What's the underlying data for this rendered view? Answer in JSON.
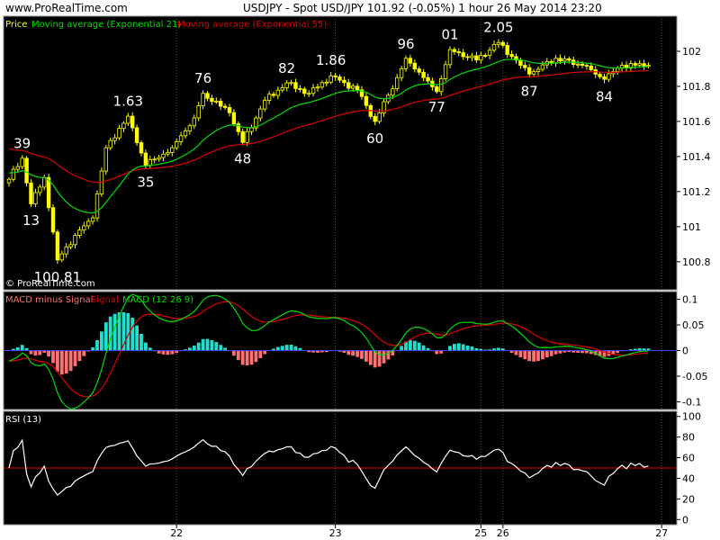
{
  "header": {
    "site": "www.ProRealTime.com",
    "title": "USDJPY - Spot USD/JPY    101.92 (-0.05%)      1 hour   26 May 2014 23:20"
  },
  "price_panel": {
    "legend": {
      "price": "Price",
      "ema": "Moving average (Exponential 21)",
      "sma": "Moving average (Exponential 55)"
    },
    "watermark": "© ProRealTime.com"
  },
  "macd_panel": {
    "legend": {
      "hist": "MACD minus Signal",
      "signal": "Signal",
      "macd": "MACD (12 26 9)"
    }
  },
  "rsi_panel": {
    "legend": "RSI (13)"
  },
  "colors": {
    "background": "#000000",
    "candle": "#ffff00",
    "ema21": "#00dd00",
    "ema55": "#dd0000",
    "hist_pos": "#22e0d0",
    "hist_neg": "#ff7070",
    "zero_line": "#4444ff",
    "rsi": "#ffffff",
    "rsi_level": "#dd0000",
    "annotation": "#ffffff"
  },
  "chart_data": [
    {
      "type": "candlestick",
      "title": "USDJPY - Spot USD/JPY",
      "ylim": [
        100.64,
        102.2
      ],
      "y_ticks": [
        100.8,
        101,
        101.2,
        101.4,
        101.6,
        101.8,
        102
      ],
      "y_tick_labels": [
        "100.8",
        "101",
        "101.2",
        "101.4",
        "101.6",
        "101.8",
        "102"
      ],
      "x_ticks": [
        {
          "label": "22",
          "bar": 38
        },
        {
          "label": "23",
          "bar": 74
        },
        {
          "label": "25",
          "bar": 107
        },
        {
          "label": "26",
          "bar": 112
        },
        {
          "label": "27",
          "bar": 148
        }
      ],
      "bars": 146,
      "anchors": [
        {
          "bar": 0,
          "close": 101.27
        },
        {
          "bar": 3,
          "close": 101.39
        },
        {
          "bar": 5,
          "close": 101.13
        },
        {
          "bar": 8,
          "close": 101.28
        },
        {
          "bar": 11,
          "close": 100.81
        },
        {
          "bar": 15,
          "close": 100.95
        },
        {
          "bar": 19,
          "close": 101.05
        },
        {
          "bar": 22,
          "close": 101.45
        },
        {
          "bar": 27,
          "close": 101.63
        },
        {
          "bar": 31,
          "close": 101.35
        },
        {
          "bar": 37,
          "close": 101.45
        },
        {
          "bar": 42,
          "close": 101.62
        },
        {
          "bar": 44,
          "close": 101.76
        },
        {
          "bar": 50,
          "close": 101.65
        },
        {
          "bar": 53,
          "close": 101.48
        },
        {
          "bar": 58,
          "close": 101.72
        },
        {
          "bar": 63,
          "close": 101.82
        },
        {
          "bar": 68,
          "close": 101.76
        },
        {
          "bar": 73,
          "close": 101.86
        },
        {
          "bar": 79,
          "close": 101.78
        },
        {
          "bar": 83,
          "close": 101.6
        },
        {
          "bar": 88,
          "close": 101.85
        },
        {
          "bar": 90,
          "close": 101.96
        },
        {
          "bar": 95,
          "close": 101.83
        },
        {
          "bar": 97,
          "close": 101.77
        },
        {
          "bar": 100,
          "close": 102.01
        },
        {
          "bar": 106,
          "close": 101.95
        },
        {
          "bar": 111,
          "close": 102.05
        },
        {
          "bar": 116,
          "close": 101.92
        },
        {
          "bar": 118,
          "close": 101.87
        },
        {
          "bar": 124,
          "close": 101.96
        },
        {
          "bar": 130,
          "close": 101.92
        },
        {
          "bar": 135,
          "close": 101.84
        },
        {
          "bar": 139,
          "close": 101.92
        },
        {
          "bar": 145,
          "close": 101.92
        }
      ],
      "series": [
        {
          "name": "Moving average (Exponential 21)",
          "period": 21
        },
        {
          "name": "Moving average (Exponential 55)",
          "period": 55
        }
      ],
      "annotations": [
        {
          "text": "39",
          "bar": 3,
          "value": 101.39,
          "pos": "above"
        },
        {
          "text": "13",
          "bar": 5,
          "value": 101.13,
          "pos": "below"
        },
        {
          "text": "100.81",
          "bar": 11,
          "value": 100.81,
          "pos": "below"
        },
        {
          "text": "1.63",
          "bar": 27,
          "value": 101.63,
          "pos": "above"
        },
        {
          "text": "35",
          "bar": 31,
          "value": 101.35,
          "pos": "below"
        },
        {
          "text": "76",
          "bar": 44,
          "value": 101.76,
          "pos": "above"
        },
        {
          "text": "48",
          "bar": 53,
          "value": 101.48,
          "pos": "below"
        },
        {
          "text": "82",
          "bar": 63,
          "value": 101.82,
          "pos": "above"
        },
        {
          "text": "1.86",
          "bar": 73,
          "value": 101.86,
          "pos": "above"
        },
        {
          "text": "60",
          "bar": 83,
          "value": 101.6,
          "pos": "below"
        },
        {
          "text": "96",
          "bar": 90,
          "value": 101.96,
          "pos": "above"
        },
        {
          "text": "77",
          "bar": 97,
          "value": 101.77,
          "pos": "below"
        },
        {
          "text": "01",
          "bar": 100,
          "value": 102.01,
          "pos": "above"
        },
        {
          "text": "2.05",
          "bar": 111,
          "value": 102.05,
          "pos": "above"
        },
        {
          "text": "87",
          "bar": 118,
          "value": 101.87,
          "pos": "below"
        },
        {
          "text": "84",
          "bar": 135,
          "value": 101.84,
          "pos": "below"
        }
      ]
    },
    {
      "type": "bar",
      "title": "MACD (12 26 9)",
      "ylim": [
        -0.115,
        0.115
      ],
      "y_ticks": [
        -0.1,
        -0.05,
        0,
        0.05,
        0.1
      ],
      "y_tick_labels": [
        "-0.1",
        "-0.05",
        "0",
        "0.05",
        "0.1"
      ],
      "series": [
        {
          "name": "MACD minus Signal",
          "kind": "histogram"
        },
        {
          "name": "Signal",
          "kind": "line"
        },
        {
          "name": "MACD (12 26 9)",
          "kind": "line"
        }
      ]
    },
    {
      "type": "line",
      "title": "RSI (13)",
      "ylim": [
        -5,
        105
      ],
      "y_ticks": [
        0,
        20,
        40,
        60,
        80,
        100
      ],
      "y_tick_labels": [
        "0",
        "20",
        "40",
        "60",
        "80",
        "100"
      ],
      "level": 50,
      "series": [
        {
          "name": "RSI (13)",
          "period": 13
        }
      ]
    }
  ]
}
